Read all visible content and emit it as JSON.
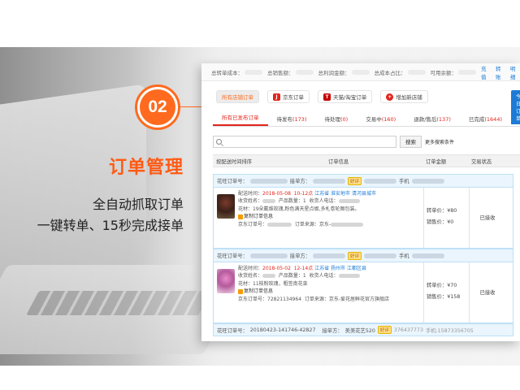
{
  "feature": {
    "step": "02",
    "title": "订单管理",
    "line1": "全自动抓取订单",
    "line2": "一键转单、15秒完成接单"
  },
  "stats": {
    "items": [
      "总转单成本：",
      "总销售额：",
      "总利润金额：",
      "总成本占比：",
      "可用余额："
    ],
    "links": [
      "充值",
      "转账",
      "明细"
    ]
  },
  "channels": [
    {
      "label": "所有店铺订单",
      "icon": ""
    },
    {
      "label": "京东订单",
      "icon": "jd-icon"
    },
    {
      "label": "天猫/淘宝订单",
      "icon": "tmall-icon"
    },
    {
      "label": "增加新店铺",
      "icon": "plus-icon"
    }
  ],
  "tabs": [
    {
      "label": "所有已发布订单",
      "count": ""
    },
    {
      "label": "待发布",
      "count": "(173)"
    },
    {
      "label": "待处理",
      "count": "(0)"
    },
    {
      "label": "交易中",
      "count": "(160)"
    },
    {
      "label": "退款/售后",
      "count": "(137)"
    },
    {
      "label": "已完成",
      "count": "(1644)"
    }
  ],
  "today_tab": "今日订单",
  "search": {
    "button": "搜索",
    "more": "更多搜索条件"
  },
  "columns": {
    "sort": "按配送时间排序",
    "info": "订单信息",
    "amount": "订单金额",
    "status": "交易状态"
  },
  "orders": [
    {
      "head_label1": "花旺订单号：",
      "head_label2": "接单方：",
      "head_flag": "好评",
      "head_phone": "手机",
      "delivery_label": "配送时间：",
      "delivery_date": "2018-05-08",
      "delivery_time": "10-12点",
      "region": "江苏省",
      "city": "淮安地市",
      "district": "清河县城市",
      "receiver_label": "收货姓名：",
      "product_label": "产品数量：",
      "product_count": "1",
      "phone_label": "收货人电话：",
      "flower_label": "花材：",
      "flower_text": "19朵戴维玫瑰,粉色满天星点缀,多札卷轮图包装。",
      "copy_label": "复制订单信息",
      "jd_label": "京东订单号：",
      "source_label": "订单来源：",
      "source_value": "京东-",
      "price_label": "转单价：",
      "price": "¥80",
      "sale_label": "销售价：",
      "sale": "¥0",
      "status": "已接收"
    },
    {
      "head_label1": "花旺订单号：",
      "head_label2": "接单方：",
      "head_flag": "好评",
      "head_phone": "手机",
      "delivery_label": "配送时间：",
      "delivery_date": "2018-05-02",
      "delivery_time": "12-14点",
      "region": "江苏省",
      "city": "扬州市",
      "district": "江都区县",
      "receiver_label": "收货姓名：",
      "product_label": "产品数量：",
      "product_count": "1",
      "phone_label": "收货人电话：",
      "flower_label": "花材：",
      "flower_text": "11枝粉玫瑰，粗签南花束",
      "copy_label": "复制订单信息",
      "jd_label": "京东订单号：",
      "jd_number": "72821134964",
      "source_label": "订单来源：",
      "source_value": "京东-爱花居鲜花官方旗舰店",
      "price_label": "转单价：",
      "price": "¥70",
      "sale_label": "销售价：",
      "sale": "¥158",
      "status": "已接收"
    }
  ],
  "order3": {
    "label": "花旺订单号：",
    "number": "20180423-141746-42827",
    "receiver_label": "接单方：",
    "receiver": "美美花艺520",
    "flag": "好评",
    "extra": "376437773",
    "phone": "手机:15873356705"
  }
}
